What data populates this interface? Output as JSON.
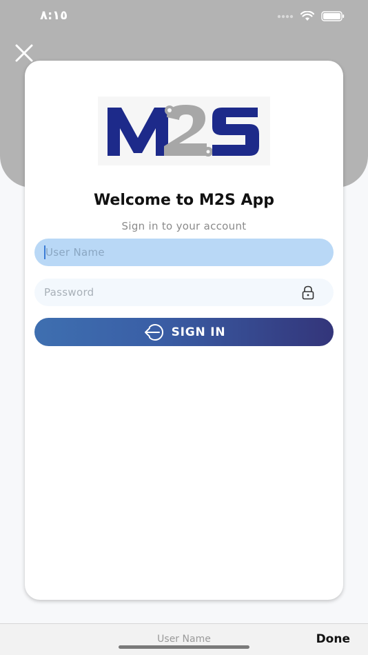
{
  "status_bar": {
    "time": "٨:١٥"
  },
  "header": {
    "close_icon": "close-icon"
  },
  "login_card": {
    "logo_text": "M2S",
    "title": "Welcome to M2S App",
    "subtitle": "Sign in to your account",
    "username_field": {
      "placeholder": "User Name",
      "value": ""
    },
    "password_field": {
      "placeholder": "Password",
      "value": "",
      "icon": "lock-icon"
    },
    "sign_in_button": {
      "label": "SIGN IN",
      "icon": "sign-in-icon"
    }
  },
  "keyboard_accessory": {
    "field_label": "User Name",
    "done_label": "Done"
  },
  "colors": {
    "brand_navy": "#1d2a8a",
    "brand_gray": "#a7a7a7",
    "input_focus_bg": "#b9d8f6",
    "button_gradient_start": "#3e6fb0",
    "button_gradient_end": "#33357a"
  }
}
